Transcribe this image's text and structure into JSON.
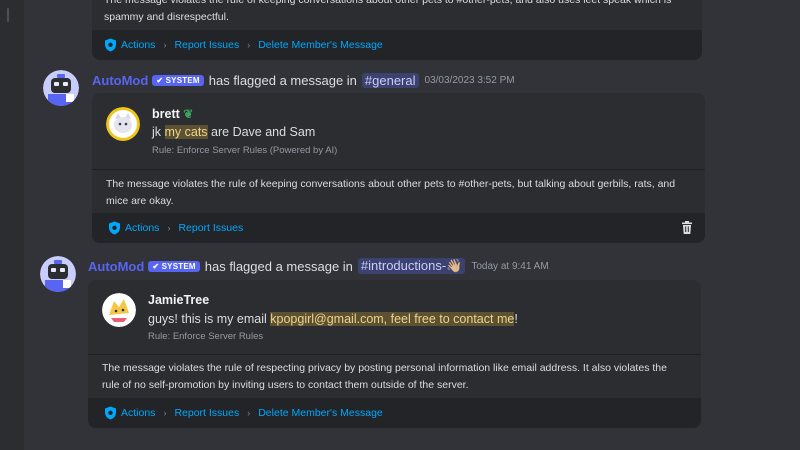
{
  "cards": [
    {
      "rule_text": "The message violates the rule of keeping conversations about other pets to #other-pets, and also uses leet speak which is spammy and disrespectful.",
      "actions": [
        "Actions",
        "Report Issues",
        "Delete Member's Message"
      ]
    },
    {
      "author": "AutoMod",
      "bot_tag": "SYSTEM",
      "flag_text": "has flagged a message in",
      "channel": "#general",
      "timestamp": "03/03/2023 3:52 PM",
      "user": "brett",
      "content_pre": "jk ",
      "content_highlight": "my cats",
      "content_post": " are Dave and Sam",
      "rule_name": "Rule: Enforce Server Rules (Powered by AI)",
      "rule_text": "The message violates the rule of keeping conversations about other pets to #other-pets, but talking about gerbils, rats, and mice are okay.",
      "actions": [
        "Actions",
        "Report Issues"
      ],
      "trash_icon": "trash-icon"
    },
    {
      "author": "AutoMod",
      "bot_tag": "SYSTEM",
      "flag_text": "has flagged a message in",
      "channel": "#introductions-👋🏼",
      "timestamp": "Today at 9:41 AM",
      "user": "JamieTree",
      "content_pre": "guys! this is my email ",
      "content_highlight": "kpopgirl@gmail.com, feel free to contact me",
      "content_post": "!",
      "rule_name": "Rule: Enforce Server Rules",
      "rule_text": "The message violates the rule of respecting privacy by posting personal information like email address. It also violates the rule of no self-promotion by inviting users to contact them outside of the server.",
      "actions": [
        "Actions",
        "Report Issues",
        "Delete Member's Message"
      ]
    }
  ],
  "icons": {
    "shield": "shield-icon",
    "chevron": "chevron-right-icon",
    "check": "check-icon",
    "sprout": "sprout-icon"
  },
  "colors": {
    "background": "#313338",
    "card": "#2b2d31",
    "action_bar": "#232428",
    "link": "#00a8fc",
    "automod": "#5865f2",
    "highlight": "#5c5130"
  }
}
